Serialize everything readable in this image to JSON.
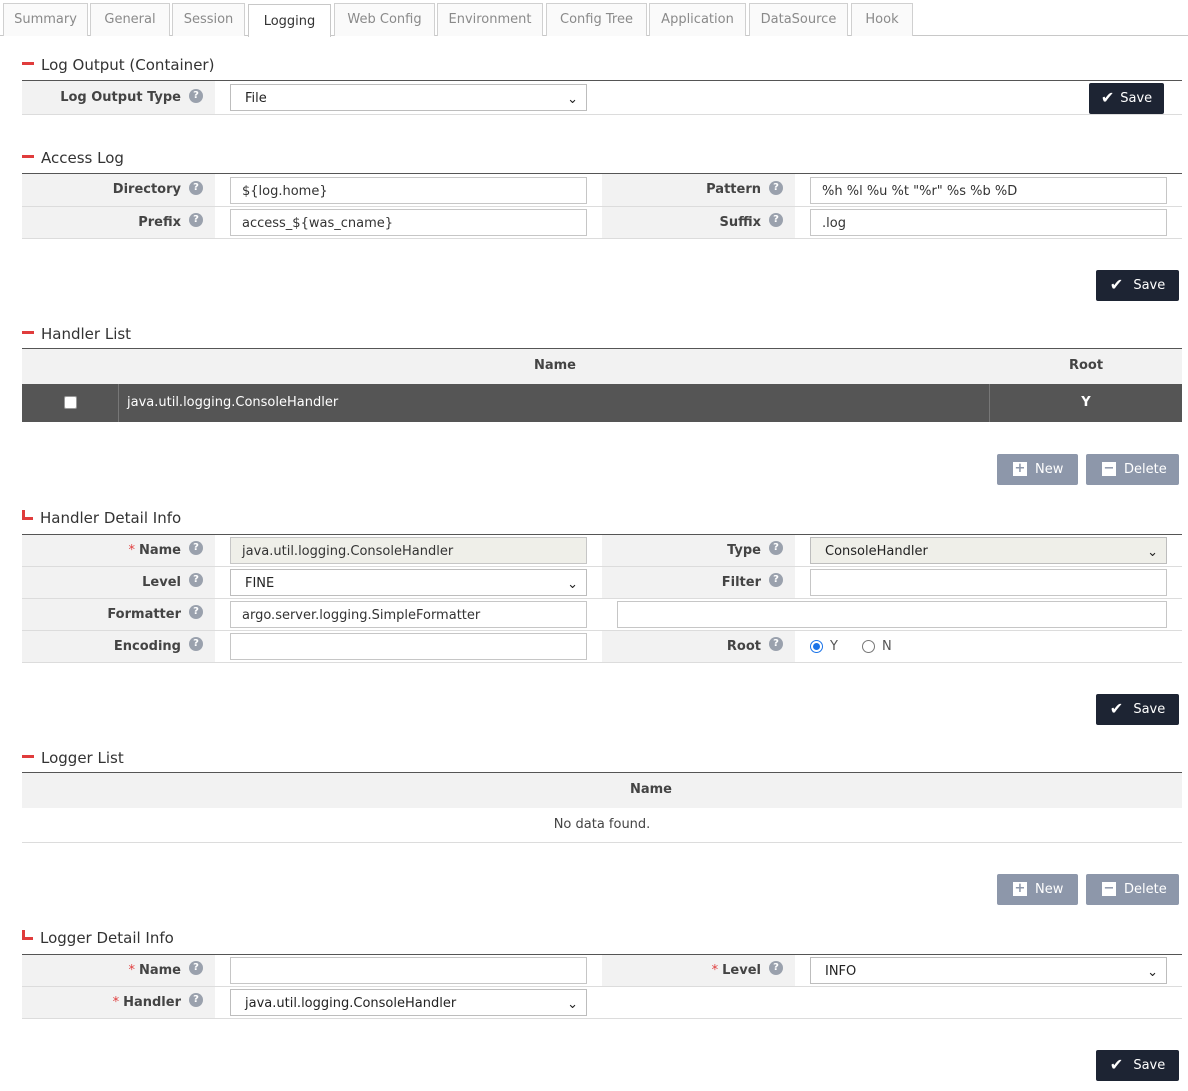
{
  "tabs": [
    {
      "label": "Summary"
    },
    {
      "label": "General"
    },
    {
      "label": "Session"
    },
    {
      "label": "Logging"
    },
    {
      "label": "Web Config"
    },
    {
      "label": "Environment"
    },
    {
      "label": "Config Tree"
    },
    {
      "label": "Application"
    },
    {
      "label": "DataSource"
    },
    {
      "label": "Hook"
    }
  ],
  "active_tab": "Logging",
  "log_output": {
    "title": "Log Output (Container)",
    "type_label": "Log Output Type",
    "type_value": "File",
    "save_label": "Save"
  },
  "access_log": {
    "title": "Access Log",
    "directory_label": "Directory",
    "directory_value": "${log.home}",
    "pattern_label": "Pattern",
    "pattern_value": "%h %l %u %t \"%r\" %s %b %D",
    "prefix_label": "Prefix",
    "prefix_value": "access_${was_cname}",
    "suffix_label": "Suffix",
    "suffix_value": ".log",
    "save_label": "Save"
  },
  "handler_list": {
    "title": "Handler List",
    "col_name": "Name",
    "col_root": "Root",
    "rows": [
      {
        "name": "java.util.logging.ConsoleHandler",
        "root": "Y"
      }
    ],
    "new_label": "New",
    "delete_label": "Delete"
  },
  "handler_detail": {
    "title": "Handler Detail Info",
    "name_label": "Name",
    "name_value": "java.util.logging.ConsoleHandler",
    "type_label": "Type",
    "type_value": "ConsoleHandler",
    "level_label": "Level",
    "level_value": "FINE",
    "filter_label": "Filter",
    "filter_value": "",
    "formatter_label": "Formatter",
    "formatter_value": "argo.server.logging.SimpleFormatter",
    "formatter_extra_value": "",
    "encoding_label": "Encoding",
    "encoding_value": "",
    "root_label": "Root",
    "root_y": "Y",
    "root_n": "N",
    "root_selected": "Y",
    "save_label": "Save"
  },
  "logger_list": {
    "title": "Logger List",
    "col_name": "Name",
    "empty_text": "No data found.",
    "new_label": "New",
    "delete_label": "Delete"
  },
  "logger_detail": {
    "title": "Logger Detail Info",
    "name_label": "Name",
    "name_value": "",
    "level_label": "Level",
    "level_value": "INFO",
    "handler_label": "Handler",
    "handler_value": "java.util.logging.ConsoleHandler",
    "save_label": "Save"
  },
  "icons": {
    "help": "?",
    "save": "check-icon",
    "new": "plus-icon",
    "delete": "minus-icon"
  },
  "colors": {
    "accent_red": "#e03c3c",
    "dark_button": "#1d2433",
    "gray_button": "#8d97aa",
    "selected_row": "#555555",
    "radio_blue": "#1a73e8"
  }
}
